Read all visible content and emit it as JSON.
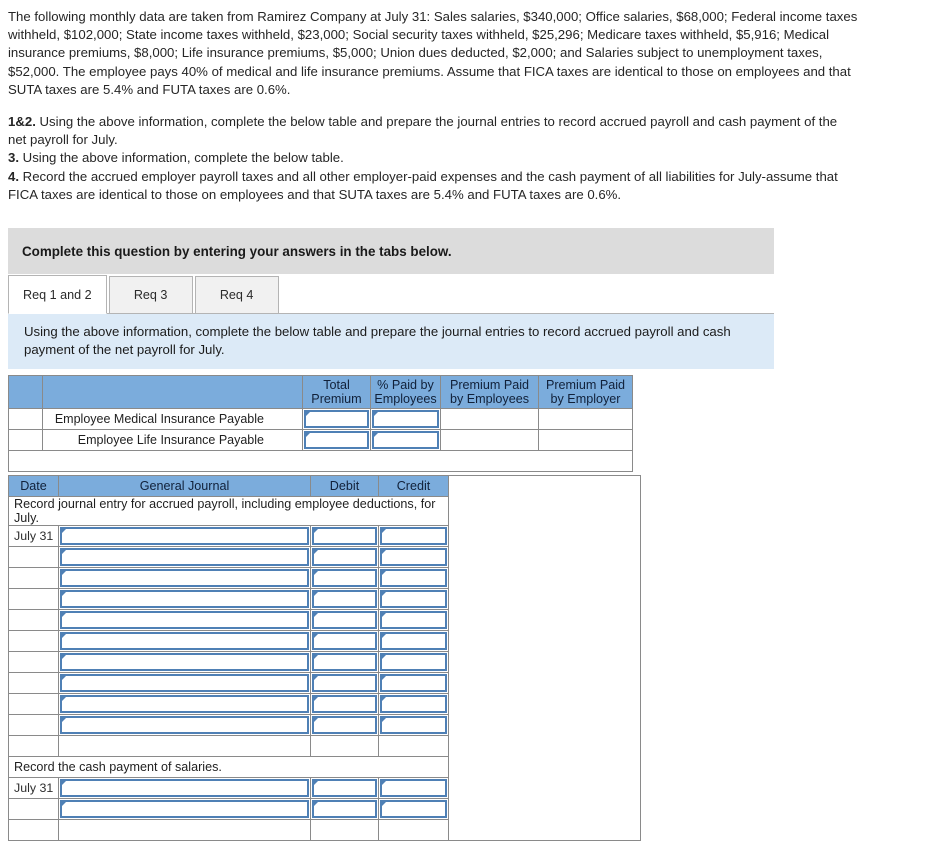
{
  "problem": {
    "statement": "The following monthly data are taken from Ramirez Company at July 31: Sales salaries, $340,000; Office salaries, $68,000; Federal income taxes withheld, $102,000; State income taxes withheld, $23,000; Social security taxes withheld, $25,296; Medicare taxes withheld, $5,916; Medical insurance premiums, $8,000; Life insurance premiums, $5,000; Union dues deducted, $2,000; and Salaries subject to unemployment taxes, $52,000. The employee pays 40% of medical and life insurance premiums. Assume that FICA taxes are identical to those on employees and that SUTA taxes are 5.4% and FUTA taxes are 0.6%."
  },
  "requirements": [
    {
      "num": "1&2.",
      "text": " Using the above information, complete the below table and prepare the journal entries to record accrued payroll and cash payment of the net payroll for July."
    },
    {
      "num": "3.",
      "text": " Using the above information, complete the below table."
    },
    {
      "num": "4.",
      "text": " Record the accrued employer payroll taxes and all other employer-paid expenses and the cash payment of all liabilities for July-assume that FICA taxes are identical to those on employees and that SUTA taxes are 5.4% and FUTA taxes are 0.6%."
    }
  ],
  "banner": {
    "text": "Complete this question by entering your answers in the tabs below."
  },
  "tabs": [
    {
      "label": "Req 1 and 2",
      "active": true
    },
    {
      "label": "Req 3",
      "active": false
    },
    {
      "label": "Req 4",
      "active": false
    }
  ],
  "instruction": {
    "text": "Using the above information, complete the below table and prepare the journal entries to record accrued payroll and cash payment of the net payroll for July."
  },
  "premium_table": {
    "headers": [
      "",
      "",
      "Total Premium",
      "% Paid by Employees",
      "Premium Paid by Employees",
      "Premium Paid by Employer"
    ],
    "header_lines": [
      [
        "",
        ""
      ],
      [
        "",
        ""
      ],
      [
        "Total",
        "Premium"
      ],
      [
        "% Paid by",
        "Employees"
      ],
      [
        "Premium Paid",
        "by Employees"
      ],
      [
        "Premium Paid",
        "by Employer"
      ]
    ],
    "rows": [
      {
        "label": "Employee Medical Insurance Payable",
        "total_premium": "",
        "pct_paid_by_employees": "",
        "premium_paid_by_employees": "",
        "premium_paid_by_employer": ""
      },
      {
        "label": "Employee Life Insurance Payable",
        "total_premium": "",
        "pct_paid_by_employees": "",
        "premium_paid_by_employees": "",
        "premium_paid_by_employer": ""
      }
    ]
  },
  "journal_table": {
    "headers": [
      "Date",
      "General Journal",
      "Debit",
      "Credit"
    ],
    "sections": [
      {
        "title": "Record journal entry for accrued payroll, including employee deductions, for July.",
        "rows": [
          {
            "date": "July 31",
            "account": "",
            "debit": "",
            "credit": ""
          },
          {
            "date": "",
            "account": "",
            "debit": "",
            "credit": ""
          },
          {
            "date": "",
            "account": "",
            "debit": "",
            "credit": ""
          },
          {
            "date": "",
            "account": "",
            "debit": "",
            "credit": ""
          },
          {
            "date": "",
            "account": "",
            "debit": "",
            "credit": ""
          },
          {
            "date": "",
            "account": "",
            "debit": "",
            "credit": ""
          },
          {
            "date": "",
            "account": "",
            "debit": "",
            "credit": ""
          },
          {
            "date": "",
            "account": "",
            "debit": "",
            "credit": ""
          },
          {
            "date": "",
            "account": "",
            "debit": "",
            "credit": ""
          },
          {
            "date": "",
            "account": "",
            "debit": "",
            "credit": ""
          }
        ]
      },
      {
        "title": "Record the cash payment of salaries.",
        "rows": [
          {
            "date": "July 31",
            "account": "",
            "debit": "",
            "credit": ""
          },
          {
            "date": "",
            "account": "",
            "debit": "",
            "credit": ""
          }
        ]
      }
    ]
  },
  "colors": {
    "header_blue": "#7bacdc",
    "instruction_blue": "#dceaf7",
    "banner_gray": "#dcdcdc",
    "input_border_blue": "#4f80b5",
    "grid_line": "#8a8a8a"
  }
}
